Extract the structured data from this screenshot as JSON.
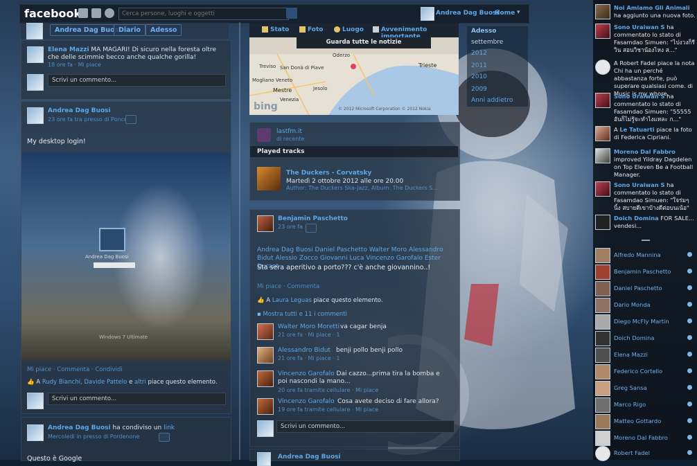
{
  "topbar": {
    "logo": "facebook",
    "search_placeholder": "Cerca persone, luoghi e oggetti",
    "user_name": "Andrea Dag Buosi",
    "home_label": "Home"
  },
  "profile_nav": {
    "name": "Andrea Dag Buosi",
    "diario": "Diario",
    "adesso": "Adesso"
  },
  "composer": {
    "stato": "Stato",
    "foto": "Foto",
    "luogo": "Luogo",
    "evento": "Avvenimento importante",
    "notizie": "Guarda tutte le notizie"
  },
  "years": [
    "Adesso",
    "settembre",
    "2012",
    "2011",
    "2010",
    "2009",
    "Anni addietro"
  ],
  "col1": {
    "top_comment": {
      "author": "Elena Mazzi",
      "text": "MA MAGARI! Di sicuro nella foresta oltre che delle scimmie becco anche qualche gorilla!",
      "time": "18 ore fa",
      "likes": "Mi piace"
    },
    "write_comment": "Scrivi un commento...",
    "post2": {
      "author": "Andrea Dag Buosi",
      "time": "23 ore fa tra presso di Ponce",
      "text": "My desktop login!",
      "actions": "Mi piace · Commenta · Condividi",
      "likes_text_a": "A",
      "likers": "Rudy Bianchi, Davide Pattelo",
      "likes_text_b": "e",
      "likes_others": "altri",
      "likes_text_c": "piace questo elemento.",
      "write": "Scrivi un commento...",
      "login_label": "Andrea Dag Buosi",
      "os_brand": "Windows 7 Ultimate"
    },
    "post3": {
      "author": "Andrea Dag Buosi",
      "shared": "ha condiviso un",
      "shared_link": "link",
      "time": "Mercoledì in presso di Pordenone",
      "text": "Questo è Google"
    }
  },
  "map": {
    "towns": [
      "Oderzo",
      "San Donà di Piave",
      "Treviso",
      "Mogliano Veneto",
      "Mestre",
      "Venezia",
      "Trieste",
      "Jesolo"
    ],
    "brand": "bing",
    "copyright": "© 2012 Microsoft Corporation © 2012 Nokia"
  },
  "music": {
    "app": "lastfm.it",
    "subtitle": "di recente",
    "section": "Played tracks",
    "track": "The Duckers - Corvatsky",
    "date": "Martedì 2 ottobre 2012 alle ore 20.00",
    "author": "Author: The Duckers Ska-Jazz, Album: The Duckers S..."
  },
  "post_center": {
    "author": "Benjamin Paschetto",
    "time": "23 ore fa",
    "tags": "Andrea Dag Buosi Daniel Paschetto Walter Moro Alessandro Bidut Alessio Zocco Giovanni Luca Vincenzo Garofalo Ester Durant",
    "text": "Sta sera aperitivo a porto??? c'è anche giovannino..!",
    "actions": "Mi piace · Commenta",
    "likes_a": "A",
    "likers": "Laura Leguas",
    "likes_b": "piace questo elemento.",
    "show_all": "Mostra tutti e 11 i commenti",
    "comments": [
      {
        "author": "Walter Moro Moretti",
        "text": "va cagar benja",
        "meta": "21 ore fa · Mi piace · 1"
      },
      {
        "author": "Alessandro Bidut",
        "text": "benji pollo benji pollo",
        "meta": "21 ore fa · Mi piace · 1"
      },
      {
        "author": "Vincenzo Garofalo",
        "text": "Dai cazzo...prima tira la bomba e poi nascondi la mano...",
        "meta": "20 ore fa tramite cellulare · Mi piace"
      },
      {
        "author": "Vincenzo Garofalo",
        "text": "Cosa avete deciso di fare allora?",
        "meta": "19 ore fa tramite cellulare · Mi piace"
      }
    ],
    "write": "Scrivi un commento...",
    "next_author": "Andrea Dag Buosi"
  },
  "ticker": [
    {
      "name": "Noi Amiamo Gli Animali",
      "text": "ha aggiunto una nuova foto."
    },
    {
      "name": "Sono Uraiwan S",
      "text": "ha commentato lo stato di Fasamdao Simuen: \"ไปงวงก็รีวิน สอนวิชาน้องไหง ส...\""
    },
    {
      "name": "Robert Fadel",
      "text": "A Robert Fadel piace la nota Chi ha un perché abbastanza forte, può superare qualsiasi come. di Music is my whore."
    },
    {
      "name": "Sono Uraiwan S",
      "text": "ha commentato lo stato di Fasamdao Simuen: \"55555 อันก็ไม่รู้จะทำไงแหละ ก...\""
    },
    {
      "name": "Le Tatuarti",
      "text": "piace la foto di Federica Cipriani."
    },
    {
      "name": "Moreno Dal Fabbro",
      "text": "improved Yildray Dagdelen on Top Eleven Be a Football Manager."
    },
    {
      "name": "Sono Uraiwan S",
      "text": "ha commentato lo stato di Fasamdao Simuen: \"ใจร่มๆ นิ้ง สบายดีเขาบ้างดีต่อบนเน้อ\""
    },
    {
      "name": "Doich Domina",
      "text": "FOR SALE... vendesi..."
    }
  ],
  "chat": [
    "Alfredo Mannina",
    "Benjamin Paschetto",
    "Daniel Paschetto",
    "Dario Monda",
    "Diego McFly Martin",
    "Doich Domina",
    "Elena Mazzi",
    "Federico Cortello",
    "Greg Sansa",
    "Marco Rigo",
    "Matteo Gottardo",
    "Moreno Dal Fabbro",
    "Robert Fadel"
  ],
  "colors": {
    "accent": "#5fa7e6",
    "topbar": "#1b2634"
  }
}
